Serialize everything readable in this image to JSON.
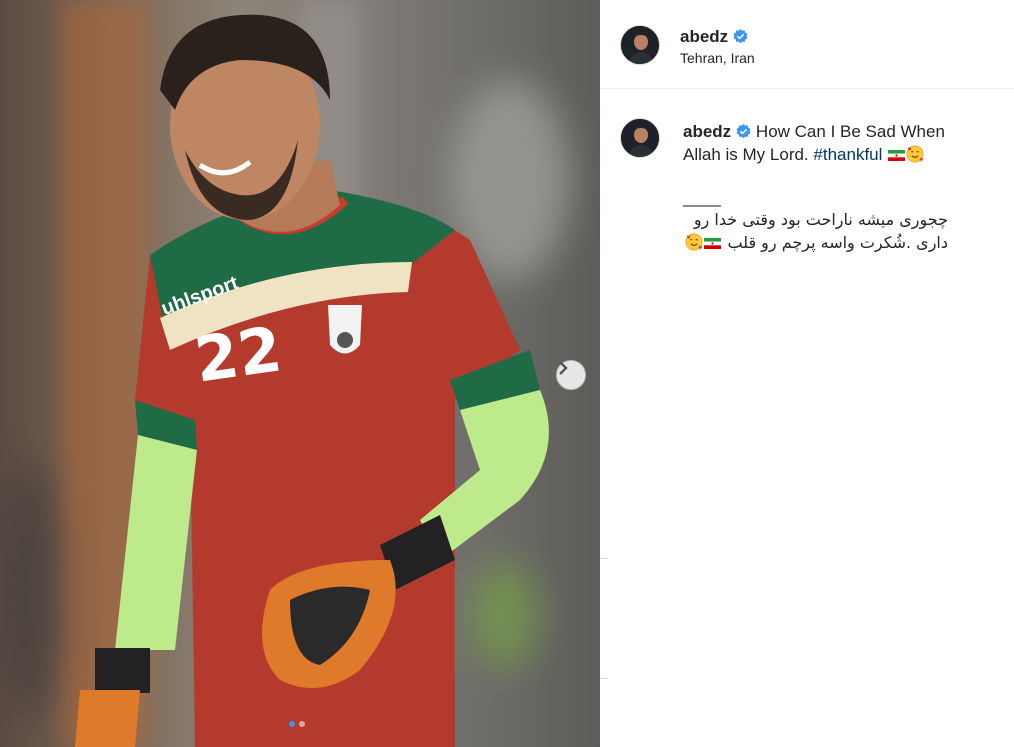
{
  "post": {
    "username": "abedz",
    "location": "Tehran, Iran",
    "caption_text": "How Can I Be Sad When Allah is My Lord.",
    "hashtag": "#thankful",
    "divider": "____",
    "caption_farsi_line1": "چجوری میشه ناراحت بود وقتی خدا رو",
    "caption_farsi_line2": "داری .شُکرت واسه پرچم رو قلب",
    "jersey_number": "22",
    "jersey_brand": "uhlsport"
  },
  "carousel": {
    "current": 1,
    "total": 2
  },
  "icons": {
    "verified": "verified-badge-icon",
    "next": "chevron-right-icon",
    "flag": "iran-flag-icon",
    "emoji": "smiling-face-with-hearts-icon"
  },
  "colors": {
    "verified": "#3897f0",
    "hashtag": "#00376b",
    "jersey_red": "#b33a2c",
    "jersey_green": "#1f6b45"
  }
}
